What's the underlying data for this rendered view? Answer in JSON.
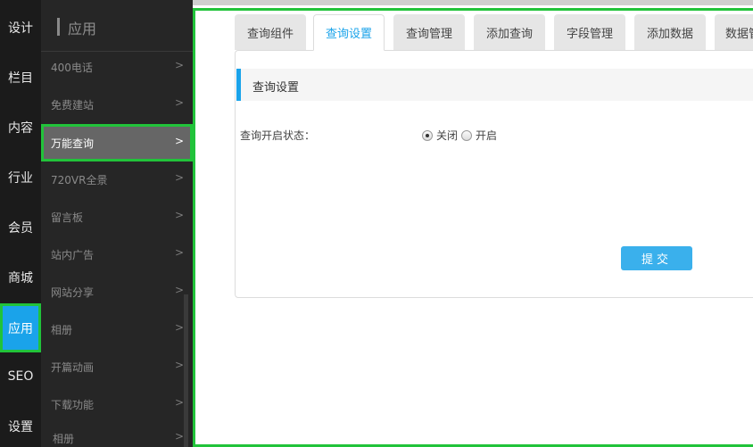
{
  "nav": {
    "items": [
      {
        "label": "设计"
      },
      {
        "label": "栏目"
      },
      {
        "label": "内容"
      },
      {
        "label": "行业"
      },
      {
        "label": "会员"
      },
      {
        "label": "商城"
      },
      {
        "label": "应用",
        "active": true
      },
      {
        "label": "SEO"
      },
      {
        "label": "设置"
      }
    ]
  },
  "menu": {
    "title": "应用",
    "items": [
      {
        "label": "400电话"
      },
      {
        "label": "免费建站"
      },
      {
        "label": "万能查询",
        "active": true
      },
      {
        "label": "720VR全景"
      },
      {
        "label": "留言板"
      },
      {
        "label": "站内广告"
      },
      {
        "label": "网站分享"
      },
      {
        "label": "相册"
      },
      {
        "label": "开篇动画"
      },
      {
        "label": "下载功能"
      },
      {
        "label": "相册"
      }
    ],
    "chevron_icon": "chevron-right-icon"
  },
  "tabs": [
    {
      "label": "查询组件"
    },
    {
      "label": "查询设置",
      "active": true
    },
    {
      "label": "查询管理"
    },
    {
      "label": "添加查询"
    },
    {
      "label": "字段管理"
    },
    {
      "label": "添加数据"
    },
    {
      "label": "数据管"
    }
  ],
  "section": {
    "title": "查询设置"
  },
  "form": {
    "field_label": "查询开启状态：",
    "options": [
      {
        "label": "关闭",
        "checked": true
      },
      {
        "label": "开启",
        "checked": false
      }
    ],
    "submit_label": "提交"
  },
  "colors": {
    "accent": "#1aa3ea",
    "highlight_border": "#21c33a",
    "nav_bg": "#1b1b1b",
    "menu_bg": "#262626"
  }
}
